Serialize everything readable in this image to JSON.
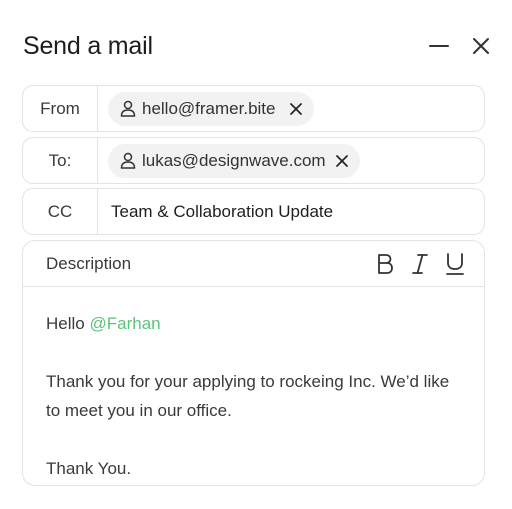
{
  "header": {
    "title": "Send a mail"
  },
  "fields": {
    "from": {
      "label": "From",
      "chip": "hello@framer.bite"
    },
    "to": {
      "label": "To:",
      "chip": "lukas@designwave.com"
    },
    "cc": {
      "label": "CC",
      "value": "Team & Collaboration Update"
    }
  },
  "description": {
    "label": "Description",
    "toolbar": [
      "bold-icon",
      "italic-icon",
      "underline-icon"
    ],
    "greeting": "Hello",
    "mention": "@Farhan",
    "mention_color": "#5cc47a",
    "body_line": "Thank you for your  applying to rockeing Inc. We’d like to meet you in our office.",
    "closing": "Thank You."
  }
}
